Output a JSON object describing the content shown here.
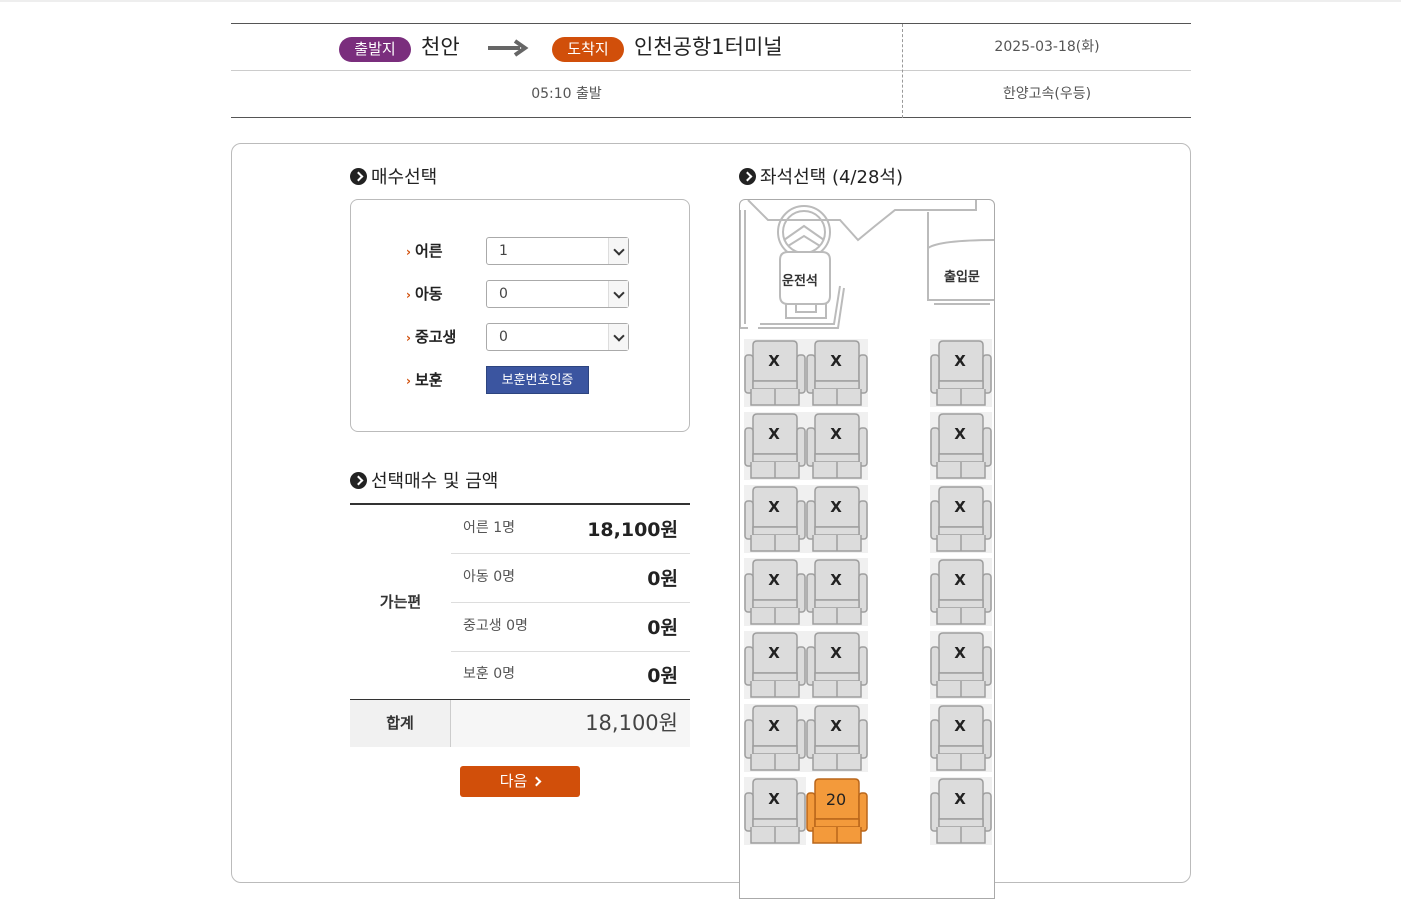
{
  "route": {
    "departure_badge": "출발지",
    "departure": "천안",
    "arrival_badge": "도착지",
    "arrival": "인천공항1터미널",
    "date": "2025-03-18(화)",
    "departure_time": "05:10 출발",
    "company": "한양고속(우등)"
  },
  "quantity": {
    "title": "매수선택",
    "adult_label": "어른",
    "adult_value": "1",
    "child_label": "아동",
    "child_value": "0",
    "student_label": "중고생",
    "student_value": "0",
    "veteran_label": "보훈",
    "veteran_button": "보훈번호인증"
  },
  "price": {
    "title": "선택매수 및 금액",
    "going_label": "가는편",
    "rows": [
      {
        "label": "어른 1명",
        "value": "18,100원"
      },
      {
        "label": "아동 0명",
        "value": "0원"
      },
      {
        "label": "중고생 0명",
        "value": "0원"
      },
      {
        "label": "보훈 0명",
        "value": "0원"
      }
    ],
    "total_label": "합계",
    "total_value": "18,100원"
  },
  "next_button": "다음",
  "seatmap": {
    "title": "좌석선택 (4/28석)",
    "driver_label": "운전석",
    "door_label": "출입문",
    "seats": [
      {
        "label": "X",
        "state": "taken"
      },
      {
        "label": "X",
        "state": "taken"
      },
      {
        "label": "X",
        "state": "taken"
      },
      {
        "label": "X",
        "state": "taken"
      },
      {
        "label": "X",
        "state": "taken"
      },
      {
        "label": "X",
        "state": "taken"
      },
      {
        "label": "X",
        "state": "taken"
      },
      {
        "label": "X",
        "state": "taken"
      },
      {
        "label": "X",
        "state": "taken"
      },
      {
        "label": "X",
        "state": "taken"
      },
      {
        "label": "X",
        "state": "taken"
      },
      {
        "label": "X",
        "state": "taken"
      },
      {
        "label": "X",
        "state": "taken"
      },
      {
        "label": "X",
        "state": "taken"
      },
      {
        "label": "X",
        "state": "taken"
      },
      {
        "label": "X",
        "state": "taken"
      },
      {
        "label": "X",
        "state": "taken"
      },
      {
        "label": "X",
        "state": "taken"
      },
      {
        "label": "X",
        "state": "taken"
      },
      {
        "label": "20",
        "state": "selected"
      },
      {
        "label": "X",
        "state": "taken"
      }
    ]
  },
  "colors": {
    "departure_badge": "#7a2e7d",
    "arrival_badge": "#d14f0a",
    "selected_seat": "#f39a3b",
    "veteran_button": "#3b55a0",
    "next_button": "#d14f0a"
  }
}
